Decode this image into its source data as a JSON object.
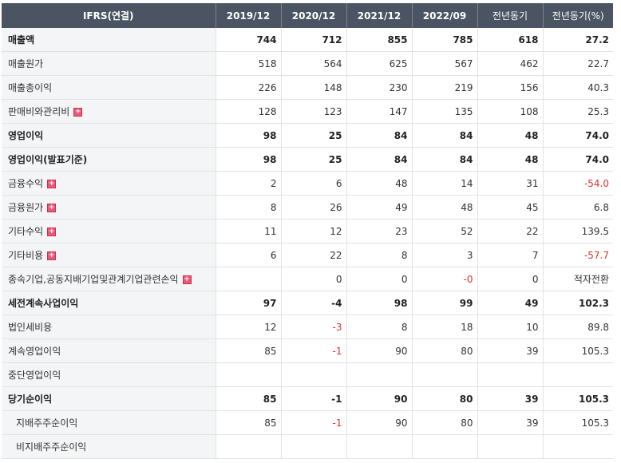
{
  "table": {
    "headers": [
      "IFRS(연결)",
      "2019/12",
      "2020/12",
      "2021/12",
      "2022/09",
      "전년동기",
      "전년동기(%)"
    ],
    "rows": [
      {
        "label": "매출액",
        "bold": true,
        "expand": false,
        "values": [
          "744",
          "712",
          "855",
          "785",
          "618",
          "27.2"
        ]
      },
      {
        "label": "매출원가",
        "bold": false,
        "expand": false,
        "values": [
          "518",
          "564",
          "625",
          "567",
          "462",
          "22.7"
        ]
      },
      {
        "label": "매출총이익",
        "bold": false,
        "expand": false,
        "values": [
          "226",
          "148",
          "230",
          "219",
          "156",
          "40.3"
        ]
      },
      {
        "label": "판매비와관리비",
        "bold": false,
        "expand": true,
        "values": [
          "128",
          "123",
          "147",
          "135",
          "108",
          "25.3"
        ]
      },
      {
        "label": "영업이익",
        "bold": true,
        "expand": false,
        "values": [
          "98",
          "25",
          "84",
          "84",
          "48",
          "74.0"
        ]
      },
      {
        "label": "영업이익(발표기준)",
        "bold": true,
        "expand": false,
        "values": [
          "98",
          "25",
          "84",
          "84",
          "48",
          "74.0"
        ]
      },
      {
        "label": "금융수익",
        "bold": false,
        "expand": true,
        "values": [
          "2",
          "6",
          "48",
          "14",
          "31",
          "-54.0"
        ]
      },
      {
        "label": "금융원가",
        "bold": false,
        "expand": true,
        "values": [
          "8",
          "26",
          "49",
          "48",
          "45",
          "6.8"
        ]
      },
      {
        "label": "기타수익",
        "bold": false,
        "expand": true,
        "values": [
          "11",
          "12",
          "23",
          "52",
          "22",
          "139.5"
        ]
      },
      {
        "label": "기타비용",
        "bold": false,
        "expand": true,
        "values": [
          "6",
          "22",
          "8",
          "3",
          "7",
          "-57.7"
        ]
      },
      {
        "label": "종속기업,공동지배기업및관계기업관련손익",
        "bold": false,
        "expand": true,
        "values": [
          "",
          "0",
          "0",
          "-0",
          "0",
          "적자전환"
        ]
      },
      {
        "label": "세전계속사업이익",
        "bold": true,
        "expand": false,
        "values": [
          "97",
          "-4",
          "98",
          "99",
          "49",
          "102.3"
        ]
      },
      {
        "label": "법인세비용",
        "bold": false,
        "expand": false,
        "values": [
          "12",
          "-3",
          "8",
          "18",
          "10",
          "89.8"
        ]
      },
      {
        "label": "계속영업이익",
        "bold": false,
        "expand": false,
        "values": [
          "85",
          "-1",
          "90",
          "80",
          "39",
          "105.3"
        ]
      },
      {
        "label": "중단영업이익",
        "bold": false,
        "expand": false,
        "values": [
          "",
          "",
          "",
          "",
          "",
          ""
        ]
      },
      {
        "label": "당기순이익",
        "bold": true,
        "expand": false,
        "values": [
          "85",
          "-1",
          "90",
          "80",
          "39",
          "105.3"
        ]
      },
      {
        "label": "지배주주순이익",
        "bold": false,
        "expand": false,
        "indent": true,
        "values": [
          "85",
          "-1",
          "90",
          "80",
          "39",
          "105.3"
        ]
      },
      {
        "label": "비지배주주순이익",
        "bold": false,
        "expand": false,
        "indent": true,
        "values": [
          "",
          "",
          "",
          "",
          "",
          ""
        ]
      }
    ]
  },
  "icons": {
    "expand": "plus-square-icon"
  },
  "colors": {
    "header_bg": "#4a5463",
    "negative": "#e0342f",
    "expand_icon": "#e9597a"
  }
}
